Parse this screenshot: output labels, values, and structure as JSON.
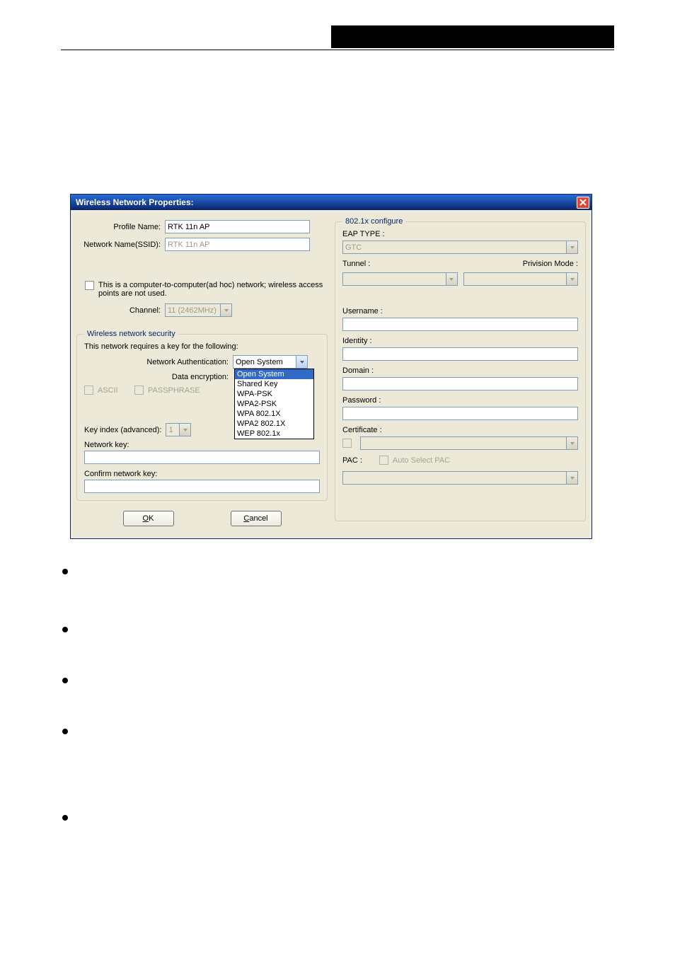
{
  "dialog": {
    "title": "Wireless Network Properties:",
    "left": {
      "profile_name_label": "Profile Name:",
      "profile_name_value": "RTK 11n AP",
      "ssid_label": "Network Name(SSID):",
      "ssid_value": "RTK 11n AP",
      "adhoc_text": "This is a computer-to-computer(ad hoc) network; wireless access points are not used.",
      "channel_label": "Channel:",
      "channel_value": "11 (2462MHz)",
      "security_legend": "Wireless network security",
      "security_desc": "This network requires a key for the following:",
      "auth_label": "Network Authentication:",
      "auth_value": "Open System",
      "auth_options": [
        "Open System",
        "Shared Key",
        "WPA-PSK",
        "WPA2-PSK",
        "WPA 802.1X",
        "WPA2 802.1X",
        "WEP 802.1x"
      ],
      "encryption_label": "Data encryption:",
      "ascii": "ASCII",
      "passphrase": "PASSPHRASE",
      "keyindex_label": "Key index (advanced):",
      "keyindex_value": "1",
      "netkey_label": "Network key:",
      "confirmkey_label": "Confirm network key:",
      "ok": "OK",
      "ok_u": "O",
      "cancel": "Cancel",
      "cancel_u": "C"
    },
    "right": {
      "legend": "802.1x configure",
      "eap_label": "EAP TYPE :",
      "eap_value": "GTC",
      "tunnel_label": "Tunnel :",
      "privision_label": "Privision Mode :",
      "username_label": "Username :",
      "identity_label": "Identity :",
      "domain_label": "Domain :",
      "password_label": "Password :",
      "certificate_label": "Certificate :",
      "pac_label": "PAC :",
      "auto_select_pac": "Auto Select PAC"
    }
  }
}
